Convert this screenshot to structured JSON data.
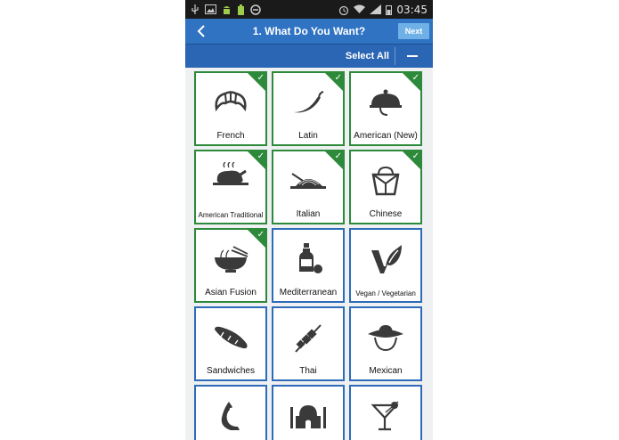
{
  "status": {
    "time": "03:45"
  },
  "header": {
    "title": "1. What Do You Want?",
    "next_label": "Next"
  },
  "subbar": {
    "select_all_label": "Select All"
  },
  "tiles": [
    {
      "label": "French",
      "selected": true,
      "icon": "croissant-icon"
    },
    {
      "label": "Latin",
      "selected": true,
      "icon": "chili-pepper-icon"
    },
    {
      "label": "American (New)",
      "selected": true,
      "icon": "cloche-icon"
    },
    {
      "label": "American Traditional",
      "selected": true,
      "icon": "roast-turkey-icon"
    },
    {
      "label": "Italian",
      "selected": true,
      "icon": "pasta-plate-icon"
    },
    {
      "label": "Chinese",
      "selected": true,
      "icon": "takeout-box-icon"
    },
    {
      "label": "Asian Fusion",
      "selected": true,
      "icon": "noodle-bowl-icon"
    },
    {
      "label": "Mediterranean",
      "selected": false,
      "icon": "olive-oil-icon"
    },
    {
      "label": "Vegan / Vegetarian",
      "selected": false,
      "icon": "vegan-leaf-icon"
    },
    {
      "label": "Sandwiches",
      "selected": false,
      "icon": "bread-icon"
    },
    {
      "label": "Thai",
      "selected": false,
      "icon": "skewer-icon"
    },
    {
      "label": "Mexican",
      "selected": false,
      "icon": "sombrero-icon"
    },
    {
      "label": "",
      "selected": false,
      "icon": "fish-icon"
    },
    {
      "label": "",
      "selected": false,
      "icon": "mosque-icon"
    },
    {
      "label": "",
      "selected": false,
      "icon": "cocktail-icon"
    }
  ],
  "colors": {
    "selected_border": "#2d8a3a",
    "unselected_border": "#2e6bb8",
    "header_bg": "#2f73c2",
    "icon": "#3a3a3a"
  }
}
